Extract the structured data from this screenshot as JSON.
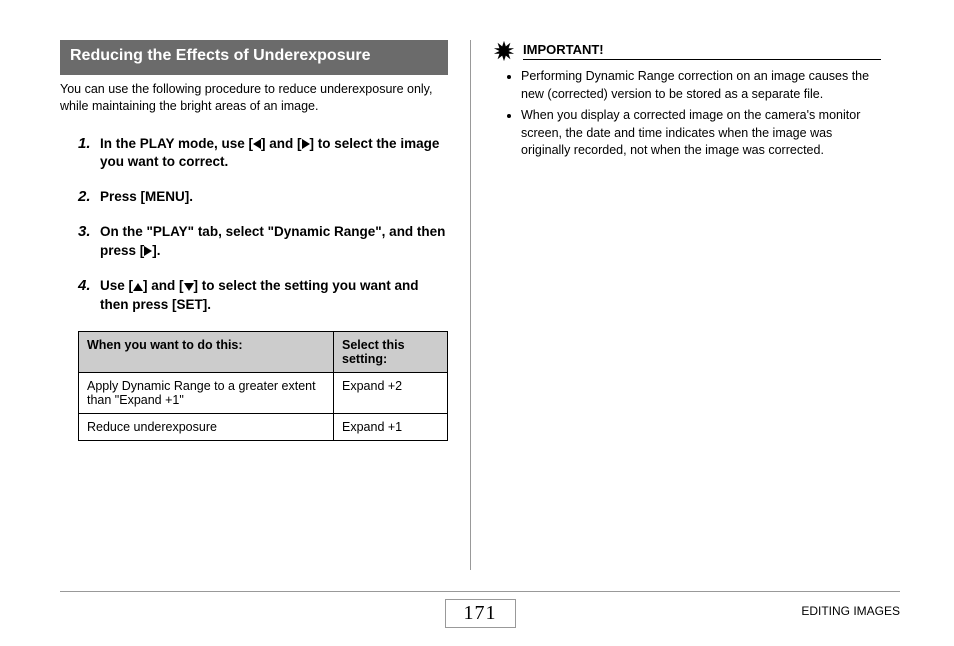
{
  "header": {
    "title": "Reducing the Effects of Underexposure"
  },
  "intro": "You can use the following procedure to reduce underexposure only, while maintaining the bright areas of an image.",
  "steps": [
    {
      "num": "1.",
      "pre": "In the PLAY mode, use [",
      "mid": "] and [",
      "post": "] to select the image you want to correct.",
      "icons": [
        "left",
        "right"
      ]
    },
    {
      "num": "2.",
      "text": "Press [MENU]."
    },
    {
      "num": "3.",
      "pre": "On the \"PLAY\" tab, select \"Dynamic Range\", and then press [",
      "post": "].",
      "icons": [
        "right"
      ]
    },
    {
      "num": "4.",
      "pre": "Use [",
      "mid": "] and [",
      "post": "] to select the setting you want and then press [SET].",
      "icons": [
        "up",
        "down"
      ]
    }
  ],
  "table": {
    "head1": "When you want to do this:",
    "head2": "Select this setting:",
    "rows": [
      {
        "c1": "Apply Dynamic Range to a greater extent than \"Expand +1\"",
        "c2": "Expand +2"
      },
      {
        "c1": "Reduce underexposure",
        "c2": "Expand +1"
      }
    ]
  },
  "important": {
    "label": "IMPORTANT!",
    "items": [
      "Performing Dynamic Range correction on an image causes the new (corrected) version to be stored as a separate file.",
      "When you display a corrected image on the camera's monitor screen, the date and time indicates when the image was originally recorded, not when the image was corrected."
    ]
  },
  "footer": {
    "page": "171",
    "section": "EDITING IMAGES"
  }
}
